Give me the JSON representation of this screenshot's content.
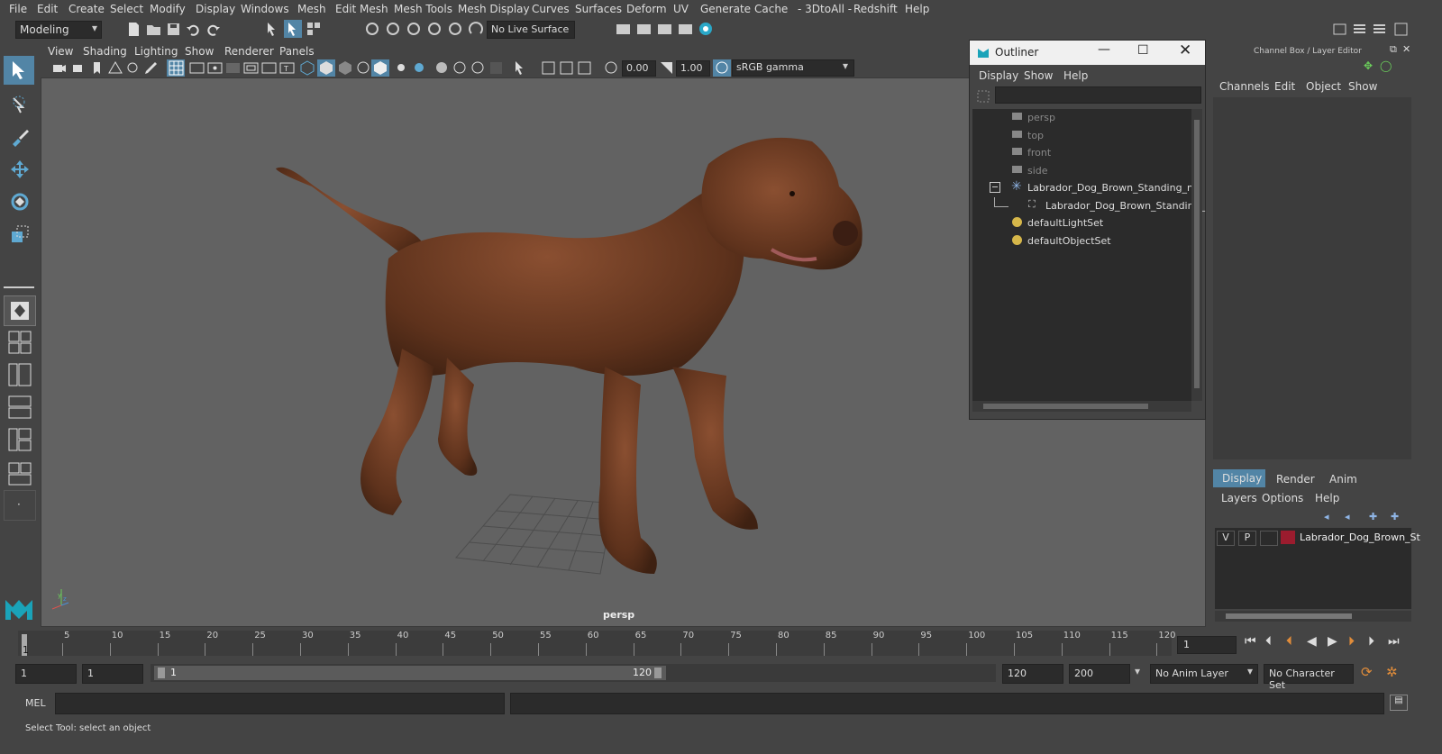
{
  "menubar": {
    "items": [
      "File",
      "Edit",
      "Create",
      "Select",
      "Modify",
      "Display",
      "Windows",
      "Mesh",
      "Edit Mesh",
      "Mesh Tools",
      "Mesh Display",
      "Curves",
      "Surfaces",
      "Deform",
      "UV",
      "Generate",
      "Cache",
      "- 3DtoAll -",
      "Redshift",
      "Help"
    ]
  },
  "shelf": {
    "mode": "Modeling",
    "live_surface": "No Live Surface"
  },
  "viewport": {
    "menu": [
      "View",
      "Shading",
      "Lighting",
      "Show",
      "Renderer",
      "Panels"
    ],
    "exposure": "0.00",
    "gamma": "1.00",
    "colorspace": "sRGB gamma",
    "camera_label": "persp"
  },
  "outliner": {
    "title": "Outliner",
    "menu": [
      "Display",
      "Show",
      "Help"
    ],
    "items": [
      {
        "label": "persp",
        "type": "camera",
        "dim": true
      },
      {
        "label": "top",
        "type": "camera",
        "dim": true
      },
      {
        "label": "front",
        "type": "camera",
        "dim": true
      },
      {
        "label": "side",
        "type": "camera",
        "dim": true
      },
      {
        "label": "Labrador_Dog_Brown_Standing_ncl",
        "type": "group",
        "dim": false
      },
      {
        "label": "Labrador_Dog_Brown_Standing_",
        "type": "mesh",
        "dim": false
      },
      {
        "label": "defaultLightSet",
        "type": "set",
        "dim": false
      },
      {
        "label": "defaultObjectSet",
        "type": "set",
        "dim": false
      }
    ]
  },
  "channel_box": {
    "title": "Channel Box / Layer Editor",
    "menu": [
      "Channels",
      "Edit",
      "Object",
      "Show"
    ]
  },
  "layer_editor": {
    "tabs": [
      "Display",
      "Render",
      "Anim"
    ],
    "menu": [
      "Layers",
      "Options",
      "Help"
    ],
    "layer": {
      "v": "V",
      "p": "P",
      "name": "Labrador_Dog_Brown_St",
      "color": "#9b1c2e"
    }
  },
  "timeline": {
    "ticks": [
      "5",
      "10",
      "15",
      "20",
      "25",
      "30",
      "35",
      "40",
      "45",
      "50",
      "55",
      "60",
      "65",
      "70",
      "75",
      "80",
      "85",
      "90",
      "95",
      "100",
      "105",
      "110",
      "115",
      "120"
    ],
    "start_tick": "1",
    "current_frame": "1"
  },
  "range": {
    "start": "1",
    "playback_start": "1",
    "slider_start": "1",
    "slider_end": "120",
    "playback_end": "120",
    "end": "200",
    "anim_layer": "No Anim Layer",
    "char_set": "No Character Set"
  },
  "command": {
    "label": "MEL"
  },
  "help_line": {
    "text": "Select Tool: select an object"
  },
  "colors": {
    "ui_bg": "#444444",
    "viewport_bg": "#626262",
    "accent": "#5285a6",
    "dog": "#6b3a22"
  }
}
